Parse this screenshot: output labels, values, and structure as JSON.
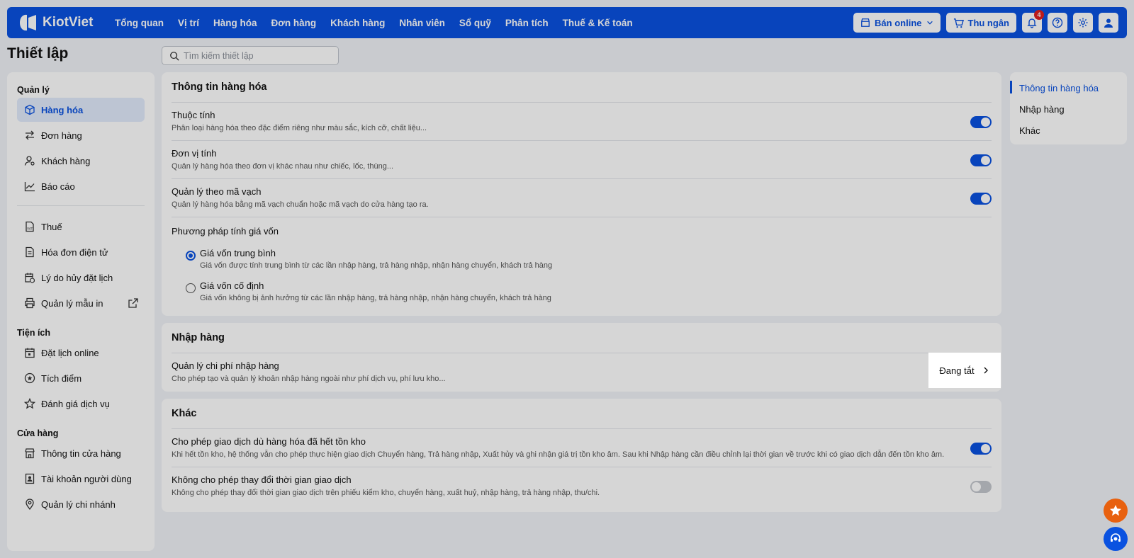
{
  "topbar": {
    "logo": "KiotViet",
    "nav": [
      "Tổng quan",
      "Vị trí",
      "Hàng hóa",
      "Đơn hàng",
      "Khách hàng",
      "Nhân viên",
      "Sổ quỹ",
      "Phân tích",
      "Thuế & Kế toán"
    ],
    "online_label": "Bán online",
    "cashier_label": "Thu ngân",
    "notification_count": "4"
  },
  "page_title": "Thiết lập",
  "search": {
    "placeholder": "Tìm kiếm thiết lập"
  },
  "sidebar": {
    "sections": [
      {
        "heading": "Quản lý",
        "items": [
          "Hàng hóa",
          "Đơn hàng",
          "Khách hàng",
          "Báo cáo"
        ]
      },
      {
        "heading": "",
        "items": [
          "Thuế",
          "Hóa đơn điện tử",
          "Lý do hủy đặt lịch",
          "Quản lý mẫu in"
        ]
      },
      {
        "heading": "Tiện ích",
        "items": [
          "Đặt lịch online",
          "Tích điểm",
          "Đánh giá dịch vụ"
        ]
      },
      {
        "heading": "Cửa hàng",
        "items": [
          "Thông tin cửa hàng",
          "Tài khoản người dùng",
          "Quản lý chi nhánh"
        ]
      }
    ]
  },
  "cards": {
    "product": {
      "title": "Thông tin hàng hóa",
      "rows": [
        {
          "title": "Thuộc tính",
          "desc": "Phân loại hàng hóa theo đặc điểm riêng như màu sắc, kích cỡ, chất liệu...",
          "on": true
        },
        {
          "title": "Đơn vị tính",
          "desc": "Quản lý hàng hóa theo đơn vị khác nhau như chiếc, lốc, thùng...",
          "on": true
        },
        {
          "title": "Quản lý theo mã vạch",
          "desc": "Quản lý hàng hóa bằng mã vạch chuẩn hoặc mã vạch do cửa hàng tạo ra.",
          "on": true
        }
      ],
      "cost_method": {
        "title": "Phương pháp tính giá vốn",
        "options": [
          {
            "title": "Giá vốn trung bình",
            "desc": "Giá vốn được tính trung bình từ các lần nhập hàng, trả hàng nhập, nhận hàng chuyển, khách trả hàng",
            "selected": true
          },
          {
            "title": "Giá vốn cố định",
            "desc": "Giá vốn không bị ảnh hưởng từ các lần nhập hàng, trả hàng nhập, nhận hàng chuyển, khách trả hàng",
            "selected": false
          }
        ]
      }
    },
    "import": {
      "title": "Nhập hàng",
      "row": {
        "title": "Quản lý chi phí nhập hàng",
        "desc": "Cho phép tạo và quản lý khoản nhập hàng ngoài như phí dịch vụ, phí lưu kho...",
        "status": "Đang tắt"
      }
    },
    "other": {
      "title": "Khác",
      "rows": [
        {
          "title": "Cho phép giao dịch dù hàng hóa đã hết tồn kho",
          "desc": "Khi hết tồn kho, hệ thống vẫn cho phép thực hiện giao dịch Chuyển hàng, Trả hàng nhập, Xuất hủy và ghi nhận giá trị tồn kho âm. Sau khi Nhập hàng cần điều chỉnh lại thời gian về trước khi có giao dịch dẫn đến tồn kho âm.",
          "on": true
        },
        {
          "title": "Không cho phép thay đổi thời gian giao dịch",
          "desc": "Không cho phép thay đổi thời gian giao dịch trên phiếu kiểm kho, chuyển hàng, xuất huỷ, nhập hàng, trả hàng nhập, thu/chi.",
          "on": false
        }
      ]
    }
  },
  "right_nav": [
    "Thông tin hàng hóa",
    "Nhập hàng",
    "Khác"
  ],
  "colors": {
    "primary": "#0a52e0",
    "fab_orange": "#e8610f"
  }
}
